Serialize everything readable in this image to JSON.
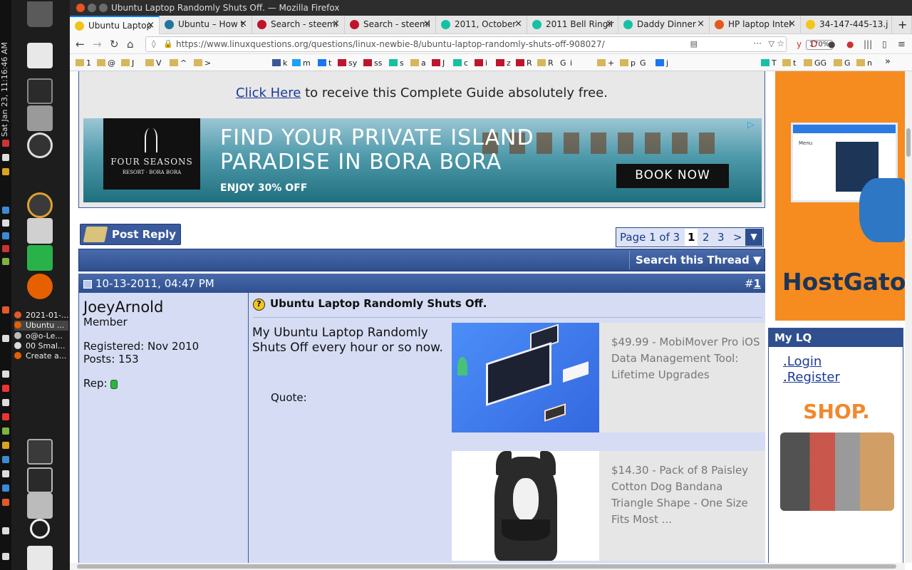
{
  "window": {
    "title": "Ubuntu Laptop Randomly Shuts Off. — Mozilla Firefox"
  },
  "clock": "Sat Jan 23, 11:16:46 AM",
  "tabs": [
    {
      "label": "Ubuntu Laptop",
      "color": "#f0c419"
    },
    {
      "label": "Ubuntu – How t",
      "color": "#21759b"
    },
    {
      "label": "Search - steemi",
      "color": "#c0142d"
    },
    {
      "label": "Search - steemi",
      "color": "#c0142d"
    },
    {
      "label": "2011, October",
      "color": "#16c1a3"
    },
    {
      "label": "2011 Bell Ringir",
      "color": "#16c1a3"
    },
    {
      "label": "Daddy Dinner",
      "color": "#16c1a3"
    },
    {
      "label": "HP laptop Intel",
      "color": "#e25a1c"
    },
    {
      "label": "34-147-445-13.j",
      "color": "#f5c518"
    }
  ],
  "taskbar": [
    {
      "label": "2021-01-...",
      "color": "#e05a2b"
    },
    {
      "label": "Ubuntu ...",
      "color": "#e66000"
    },
    {
      "label": "o@o-Le...",
      "color": "#bbbbbb"
    },
    {
      "label": "00 Smal...",
      "color": "#dddddd"
    },
    {
      "label": "Create a...",
      "color": "#e66000"
    }
  ],
  "url": "https://www.linuxquestions.org/questions/linux-newbie-8/ubuntu-laptop-randomly-shuts-off-908027/",
  "zoom": "170%",
  "bookmarks": [
    "1",
    "@",
    "J",
    "V",
    "^",
    ">",
    "k",
    "m",
    "t",
    "sy",
    "ss",
    "s",
    "a",
    "J",
    "c",
    "i",
    "z",
    "R",
    "R",
    "G",
    "i",
    "+",
    "p",
    "G",
    "j",
    "T",
    "t",
    "GG",
    "G",
    "n"
  ],
  "guide": {
    "link": "Click Here",
    "rest": " to receive this Complete Guide absolutely free."
  },
  "ad": {
    "brand": "FOUR SEASONS",
    "brand_sub": "RESORT · BORA BORA",
    "line1": "FIND YOUR PRIVATE ISLAND",
    "line2": "PARADISE IN BORA BORA",
    "line3": "ENJOY 30% OFF",
    "cta": "BOOK NOW"
  },
  "thread": {
    "post_reply": "Post Reply",
    "pager_label": "Page 1 of 3",
    "pages": [
      "1",
      "2",
      "3",
      ">"
    ],
    "search": "Search this Thread ▼"
  },
  "post": {
    "date": "10-13-2011, 04:47 PM",
    "number_prefix": "#",
    "number": "1",
    "title": "Ubuntu Laptop Randomly Shuts Off.",
    "message": "My Ubuntu Laptop Randomly Shuts Off every hour or so now.",
    "quote_label": "Quote:"
  },
  "user": {
    "name": "JoeyArnold",
    "role": "Member",
    "registered": "Registered: Nov 2010",
    "posts": "Posts: 153",
    "rep": "Rep:"
  },
  "products": [
    {
      "text": "$49.99 - MobiMover Pro iOS Data Management Tool: Lifetime Upgrades"
    },
    {
      "text": "$14.30 - Pack of 8 Paisley Cotton Dog Bandana Triangle Shape - One Size Fits Most ..."
    }
  ],
  "sidebar": {
    "hostgator": "HostGato",
    "mock_label": "Menu",
    "mylq_title": "My LQ",
    "login": "Login",
    "register": "Register",
    "shop": "SHOP."
  }
}
